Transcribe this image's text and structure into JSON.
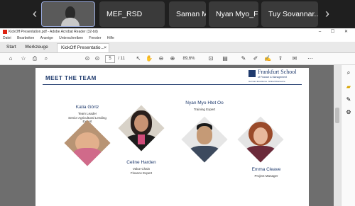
{
  "meeting_bar": {
    "prev_arrow": "‹",
    "next_arrow": "›",
    "participants": [
      {
        "name": "MEF_RSD"
      },
      {
        "name": "Saman Meas..."
      },
      {
        "name": "Nyan Myo_FS"
      },
      {
        "name": "Tuy Sovannar..."
      }
    ]
  },
  "window": {
    "title": "KickOff Presentation.pdf - Adobe Acrobat Reader (32-bit)",
    "controls": "– ☐ ✕",
    "menu": [
      "Datei",
      "Bearbeiten",
      "Anzeige",
      "Unterschreiben",
      "Fenster",
      "Hilfe"
    ],
    "tabs": {
      "start": "Start",
      "tools": "Werkzeuge",
      "document": "KickOff Presentatio...",
      "close": "×"
    },
    "toolbar": {
      "page_current": "5",
      "page_total": "/ 11",
      "zoom": "89,6%"
    }
  },
  "slide": {
    "title": "Meet the Team",
    "logo": {
      "name": "Frankfurt School",
      "sub": "of Finance & Management",
      "tagline": "German Excellence. Global Relevance."
    },
    "team": [
      {
        "name": "Katia Görtz",
        "role_lines": [
          "Team Leader",
          "Senior Agricultural Lending",
          "Expert"
        ]
      },
      {
        "name": "Celine Harden",
        "role_lines": [
          "Value Chain",
          "Finance Expert"
        ]
      },
      {
        "name": "Nyan Myo Htet Oo",
        "role_lines": [
          "Training Expert"
        ]
      },
      {
        "name": "Emma Cleave",
        "role_lines": [
          "Project Manager"
        ]
      }
    ]
  },
  "colors": {
    "brand_navy": "#1f3a6d",
    "meeting_bg": "#1f1f1f",
    "doc_bg": "#6e6e6e"
  }
}
